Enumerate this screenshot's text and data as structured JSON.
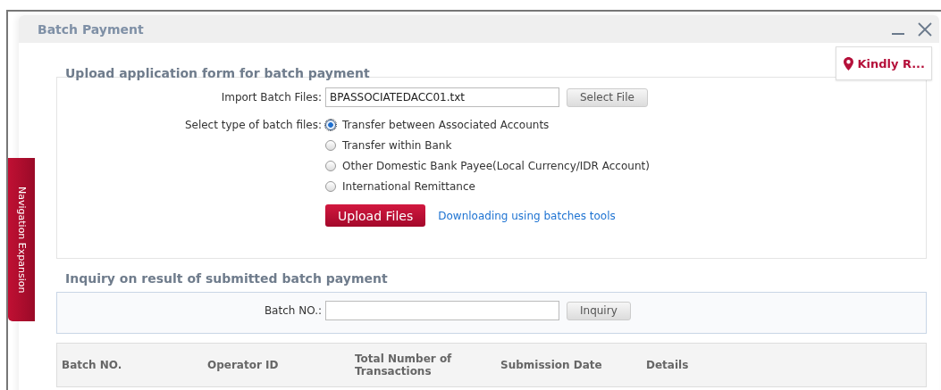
{
  "window": {
    "title": "Batch Payment"
  },
  "notice": {
    "text": "Kindly R..."
  },
  "side_tab": {
    "label": "Navigation Expansion"
  },
  "upload": {
    "heading": "Upload application form for batch payment",
    "import_label": "Import Batch Files:",
    "file_value": "BPASSOCIATEDACC01.txt",
    "select_button": "Select File",
    "type_label": "Select type of batch files:",
    "types": [
      {
        "label": "Transfer between Associated Accounts",
        "selected": true
      },
      {
        "label": "Transfer within Bank",
        "selected": false
      },
      {
        "label": "Other Domestic Bank Payee(Local Currency/IDR Account)",
        "selected": false
      },
      {
        "label": "International Remittance",
        "selected": false
      }
    ],
    "upload_button": "Upload Files",
    "tools_link": "Downloading using batches tools"
  },
  "inquiry": {
    "heading": "Inquiry on result of submitted batch payment",
    "batch_label": "Batch NO.:",
    "inquiry_button": "Inquiry"
  },
  "table": {
    "columns": [
      "Batch NO.",
      "Operator ID",
      "Total Number of Transactions",
      "Submission Date",
      "Details"
    ]
  }
}
